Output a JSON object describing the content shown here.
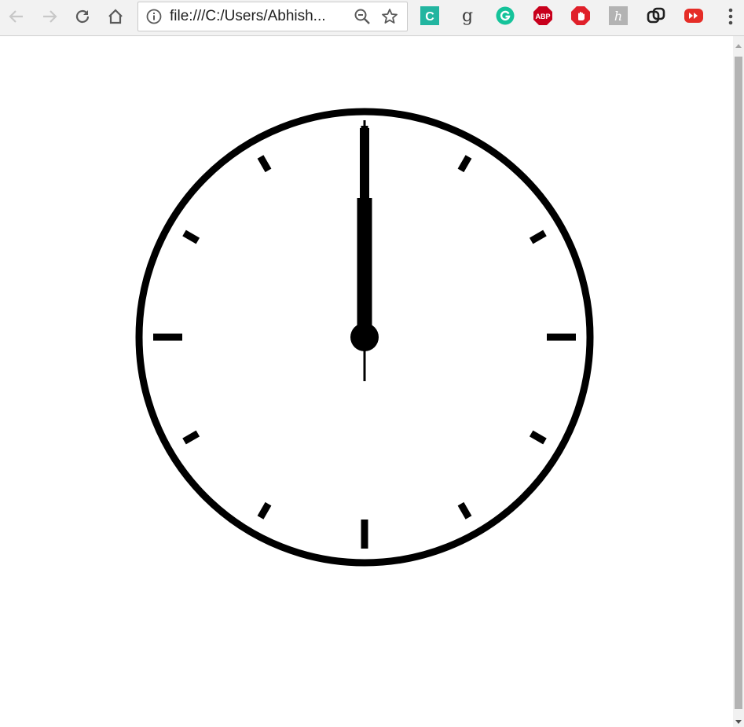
{
  "browser": {
    "address_bar": {
      "url_display": "file:///C:/Users/Abhish..."
    },
    "extensions": [
      {
        "name": "copyleaks-extension-icon",
        "color": "#22b5a0",
        "letter": "C"
      },
      {
        "name": "goodreads-extension-icon",
        "color": "#4a4a4a",
        "letter": "g"
      },
      {
        "name": "grammarly-extension-icon",
        "color": "#15c39a",
        "letter": "G"
      },
      {
        "name": "adblock-plus-extension-icon",
        "color": "#c8001c",
        "letter": "ABP"
      },
      {
        "name": "adblock-extension-icon",
        "color": "#e0202a",
        "letter": ""
      },
      {
        "name": "hacker-extension-icon",
        "color": "#b3b3b3",
        "letter": "h"
      },
      {
        "name": "link-extension-icon",
        "color": "#202020",
        "letter": ""
      },
      {
        "name": "youtube-extension-icon",
        "color": "#e52d27",
        "letter": ""
      }
    ]
  },
  "clock": {
    "hour": 12,
    "minute": 0,
    "second": 0,
    "face_color": "#ffffff",
    "stroke_color": "#000000",
    "tick_count": 12
  }
}
